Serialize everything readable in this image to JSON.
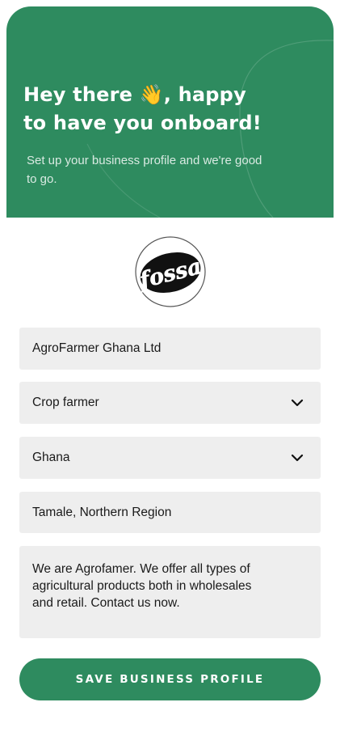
{
  "hero": {
    "title_line1": "Hey there 👋, happy",
    "title_line2": "to have you onboard!",
    "subtitle": "Set up your business profile and we're good to go."
  },
  "logo": {
    "text": "fossa"
  },
  "form": {
    "business_name": "AgroFarmer Ghana Ltd",
    "business_type": "Crop farmer",
    "country": "Ghana",
    "location": "Tamale, Northern Region",
    "description": "We are Agrofamer. We offer all types of agricultural products both in wholesales and retail. Contact us now."
  },
  "actions": {
    "save_label": "SAVE BUSINESS PROFILE"
  },
  "colors": {
    "brand_green": "#2e8b5f",
    "field_bg": "#eeeeee"
  },
  "icons": {
    "dropdown": "chevron-down-icon",
    "wave": "waving-hand-emoji"
  }
}
